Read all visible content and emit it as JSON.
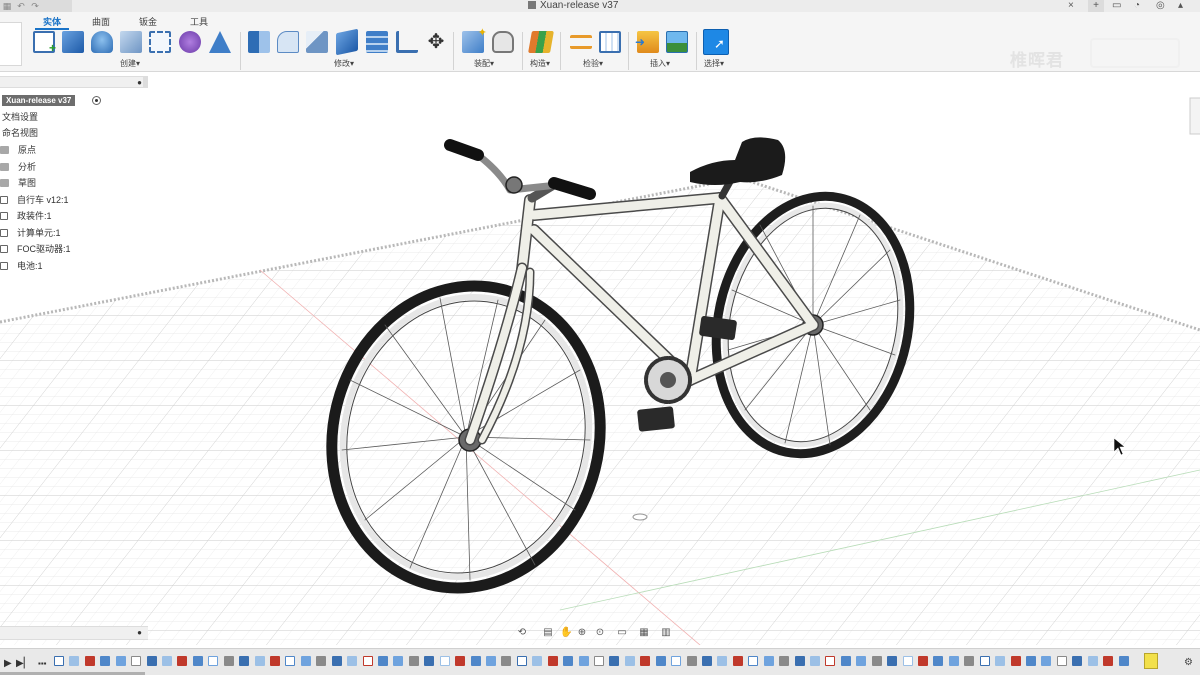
{
  "window": {
    "title": "Xuan-release v37"
  },
  "ribbon": {
    "tabs": [
      {
        "label": "实体",
        "active": true
      },
      {
        "label": "曲面",
        "active": false
      },
      {
        "label": "钣金",
        "active": false
      },
      {
        "label": "工具",
        "active": false
      }
    ],
    "groups": [
      {
        "label": "创建▾"
      },
      {
        "label": "修改▾"
      },
      {
        "label": "装配▾"
      },
      {
        "label": "构造▾"
      },
      {
        "label": "检验▾"
      },
      {
        "label": "插入▾"
      },
      {
        "label": "选择▾"
      }
    ],
    "accent": "#1a73c7"
  },
  "watermark": {
    "text": "椎晖君"
  },
  "browser": {
    "root": "Xuan-release v37",
    "items": [
      {
        "label": "文档设置",
        "icon": "settings-icon"
      },
      {
        "label": "命名视图",
        "icon": "folder-icon"
      },
      {
        "label": "原点",
        "icon": "folder-icon"
      },
      {
        "label": "分析",
        "icon": "folder-icon"
      },
      {
        "label": "草图",
        "icon": "folder-icon"
      },
      {
        "label": "自行车 v12:1",
        "icon": "component-icon"
      },
      {
        "label": "政装件:1",
        "icon": "component-icon"
      },
      {
        "label": "计算单元:1",
        "icon": "component-icon"
      },
      {
        "label": "FOC驱动器:1",
        "icon": "component-icon"
      },
      {
        "label": "电池:1",
        "icon": "component-icon"
      }
    ]
  },
  "navbar": {
    "buttons": [
      "orbit-icon",
      "look-at-icon",
      "pan-icon",
      "zoom-icon",
      "fit-icon",
      "display-settings-icon",
      "grid-icon",
      "viewports-icon"
    ]
  },
  "timeline": {
    "controls": [
      "play-icon",
      "step-forward-icon"
    ],
    "feature_count": 70
  }
}
